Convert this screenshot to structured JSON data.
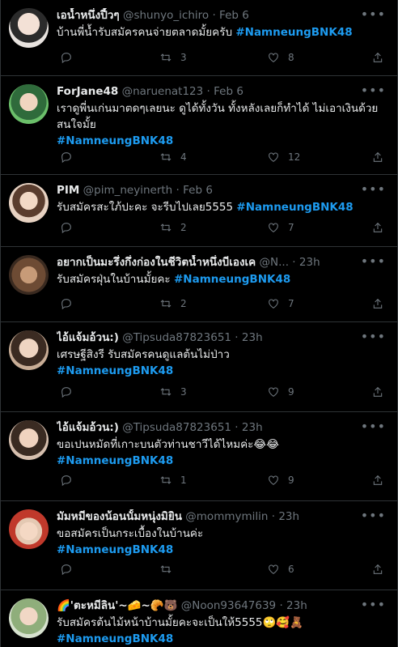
{
  "tweets": [
    {
      "name": "เอน้ำหนึ่งปี้วๆ",
      "handle": "@shunyo_ichiro",
      "dot": "·",
      "time": "Feb 6",
      "text": "บ้านพี่น้ำรับสมัครคนจ่ายตลาดมั้ยครับ ",
      "hashtag": "#NamneungBNK48",
      "retweets": "3",
      "likes": "8",
      "avatar_color": "#d8d3d0"
    },
    {
      "name": "ForJane48",
      "handle": "@naruenat123",
      "dot": "·",
      "time": "Feb 6",
      "text": "เราดูพี่นเก่นมาตดๆเลยนะ ดูได้ทั้งวัน ทั้งหลังเลยก็ทำได้ ไม่เอาเงินด้วย สนใจมั้ย",
      "hashtag": "#NamneungBNK48",
      "retweets": "4",
      "likes": "12",
      "avatar_color": "#3b7a4a"
    },
    {
      "name": "PIM",
      "handle": "@pim_neyinerth",
      "dot": "·",
      "time": "Feb 6",
      "text": "รับสมัครสะใภ้ปะคะ จะรีบไปเลย5555 ",
      "hashtag": "#NamneungBNK48",
      "retweets": "2",
      "likes": "7",
      "avatar_color": "#c9a58d"
    },
    {
      "name": "อยากเป็นมะรึ่งกึ่งก่องในชีวิตน้ำหนึ่งบีเองเค",
      "handle": "@N...",
      "dot": "·",
      "time": "23h",
      "text": "รับสมัครฝุ่นในบ้านมั้ยคะ ",
      "hashtag": "#NamneungBNK48",
      "retweets": "2",
      "likes": "7",
      "avatar_color": "#8a6a4e"
    },
    {
      "name": "ไอ้แจ้มอ้วน:)",
      "handle": "@Tipsuda87823651",
      "dot": "·",
      "time": "23h",
      "text": "เศรษฐีสิงรี รับสมัครคนดูแลต้นไม่ป่าว",
      "hashtag": "#NamneungBNK48",
      "retweets": "3",
      "likes": "9",
      "avatar_color": "#b89a82"
    },
    {
      "name": "ไอ้แจ้มอ้วน:)",
      "handle": "@Tipsuda87823651",
      "dot": "·",
      "time": "23h",
      "text": "ขอเปนหมัดที่เกาะบนตัวท่านชาวีได้ไหมค่ะ😂😂",
      "hashtag": "#NamneungBNK48",
      "retweets": "1",
      "likes": "9",
      "avatar_color": "#bfa089"
    },
    {
      "name": "มัมหมีของน้อนนั้มหนุ่งมิยิน",
      "handle": "@mommymilin",
      "dot": "·",
      "time": "23h",
      "text": "ขอสมัครเป็นกระเบื้องในบ้านค่ะ",
      "hashtag": "#NamneungBNK48",
      "retweets": "",
      "likes": "6",
      "avatar_color": "#c0392b"
    },
    {
      "name": "🌈'ตะหมีลิน'~🧀~🥐🐻",
      "handle": "@Noon93647639",
      "dot": "·",
      "time": "23h",
      "text": "รับสมัครต้นไม้หน้าบ้านมั้ยคะจะเป็นให้5555🙄🥰🧸",
      "hashtag": "#NamneungBNK48",
      "retweets": "",
      "likes": "",
      "avatar_color": "#7a8f6a"
    }
  ],
  "icons": {
    "reply": "reply-icon",
    "retweet": "retweet-icon",
    "like": "like-icon",
    "share": "share-icon",
    "more": "more-icon"
  }
}
